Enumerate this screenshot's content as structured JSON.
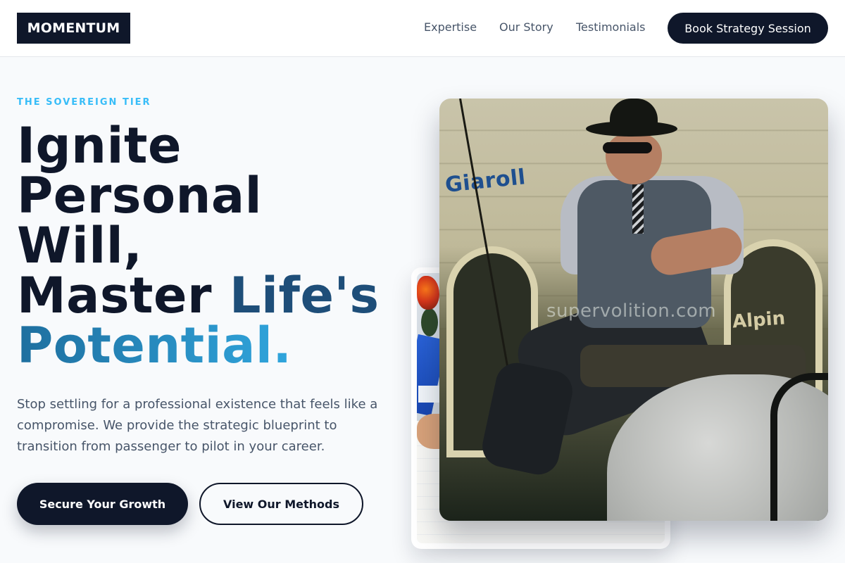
{
  "brand": {
    "logo": "MOMENTUM"
  },
  "nav": {
    "links": [
      "Expertise",
      "Our Story",
      "Testimonials"
    ],
    "cta": "Book Strategy Session"
  },
  "hero": {
    "eyebrow": "THE SOVEREIGN TIER",
    "headline": {
      "line1": "Ignite",
      "line2": "Personal",
      "line3": "Will,",
      "line4a": "Master",
      "line4b": "Life's",
      "line5": "Potential."
    },
    "lead": "Stop settling for a professional existence that feels like a compromise. We provide the strategic blueprint to transition from passenger to pilot in your career.",
    "primary_button": "Secure Your Growth",
    "secondary_button": "View Our Methods"
  },
  "media": {
    "main_image_alt": "Man in bowler hat writing while seated on a horse carriage",
    "photo_sign_text": "Giaroll",
    "photo_sign_right": "Alpin",
    "watermark": "supervolition.com",
    "back_image_alt": "Desk with notebook, flowers and a blue book"
  },
  "colors": {
    "primary": "#0f172a",
    "accent": "#38bdf8",
    "accent_dark": "#1e4e79",
    "muted_text": "#475569",
    "background": "#f8fafc"
  }
}
